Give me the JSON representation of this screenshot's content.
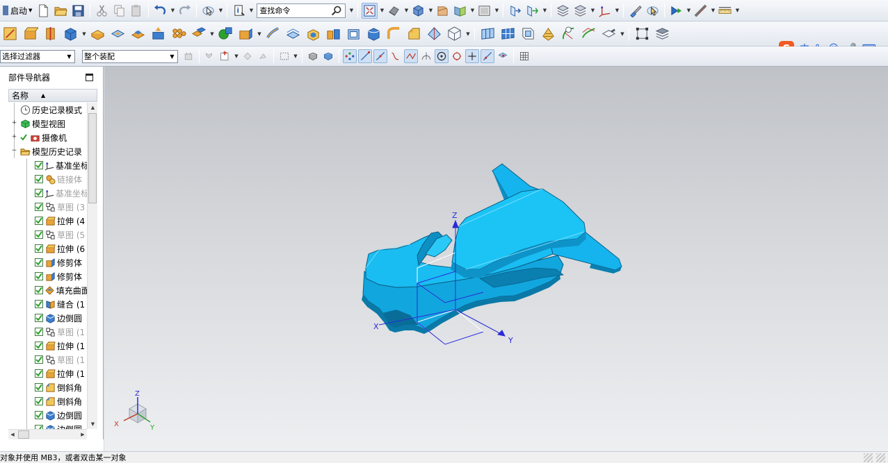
{
  "toolbar": {
    "launch_label": "启动",
    "search_value": "查找命令",
    "select_filter": "选择过滤器",
    "assembly_scope": "整个装配"
  },
  "navigator": {
    "title": "部件导航器",
    "column_name": "名称",
    "items": [
      {
        "label": "历史记录模式",
        "icon": "clock-icon",
        "level": 0,
        "expand": "",
        "checked": null,
        "dim": false
      },
      {
        "label": "模型视图",
        "icon": "model-view-icon",
        "level": 0,
        "expand": "+",
        "checked": null,
        "dim": false
      },
      {
        "label": "摄像机",
        "icon": "camera-icon",
        "level": 0,
        "expand": "+",
        "checked": true,
        "dim": false
      },
      {
        "label": "模型历史记录",
        "icon": "folder-open-icon",
        "level": 0,
        "expand": "−",
        "checked": null,
        "dim": false
      },
      {
        "label": "基准坐标系",
        "icon": "datum-csys-icon",
        "level": 1,
        "expand": "",
        "checked": true,
        "dim": false
      },
      {
        "label": "链接体",
        "icon": "linked-body-icon",
        "level": 1,
        "expand": "",
        "checked": true,
        "dim": true
      },
      {
        "label": "基准坐标系",
        "icon": "datum-csys-icon",
        "level": 1,
        "expand": "",
        "checked": true,
        "dim": true
      },
      {
        "label": "草图 (3",
        "icon": "sketch-icon",
        "level": 1,
        "expand": "",
        "checked": true,
        "dim": true
      },
      {
        "label": "拉伸 (4",
        "icon": "extrude-icon",
        "level": 1,
        "expand": "",
        "checked": true,
        "dim": false
      },
      {
        "label": "草图 (5",
        "icon": "sketch-icon",
        "level": 1,
        "expand": "",
        "checked": true,
        "dim": true
      },
      {
        "label": "拉伸 (6",
        "icon": "extrude-icon",
        "level": 1,
        "expand": "",
        "checked": true,
        "dim": false
      },
      {
        "label": "修剪体",
        "icon": "trim-body-icon",
        "level": 1,
        "expand": "",
        "checked": true,
        "dim": false
      },
      {
        "label": "修剪体",
        "icon": "trim-body-icon",
        "level": 1,
        "expand": "",
        "checked": true,
        "dim": false
      },
      {
        "label": "填充曲面",
        "icon": "fill-surface-icon",
        "level": 1,
        "expand": "",
        "checked": true,
        "dim": false
      },
      {
        "label": "缝合 (1",
        "icon": "sew-icon",
        "level": 1,
        "expand": "",
        "checked": true,
        "dim": false
      },
      {
        "label": "边倒圆",
        "icon": "edge-blend-icon",
        "level": 1,
        "expand": "",
        "checked": true,
        "dim": false
      },
      {
        "label": "草图 (1",
        "icon": "sketch-icon",
        "level": 1,
        "expand": "",
        "checked": true,
        "dim": true
      },
      {
        "label": "拉伸 (1",
        "icon": "extrude-icon",
        "level": 1,
        "expand": "",
        "checked": true,
        "dim": false
      },
      {
        "label": "草图 (1",
        "icon": "sketch-icon",
        "level": 1,
        "expand": "",
        "checked": true,
        "dim": true
      },
      {
        "label": "拉伸 (1",
        "icon": "extrude-icon",
        "level": 1,
        "expand": "",
        "checked": true,
        "dim": false
      },
      {
        "label": "倒斜角",
        "icon": "chamfer-icon",
        "level": 1,
        "expand": "",
        "checked": true,
        "dim": false
      },
      {
        "label": "倒斜角",
        "icon": "chamfer-icon",
        "level": 1,
        "expand": "",
        "checked": true,
        "dim": false
      },
      {
        "label": "边倒圆",
        "icon": "edge-blend-icon",
        "level": 1,
        "expand": "",
        "checked": true,
        "dim": false
      },
      {
        "label": "边倒圆",
        "icon": "edge-blend-icon",
        "level": 1,
        "expand": "",
        "checked": true,
        "dim": false
      }
    ]
  },
  "viewport": {
    "axis_x": "X",
    "axis_y": "Y",
    "axis_z": "Z",
    "triad_x": "X",
    "triad_y": "Y",
    "triad_z": "Z"
  },
  "status": {
    "message": "对象并使用 MB3，或者双击某一对象"
  },
  "ime": {
    "logo": "S",
    "mode": "中",
    "punct": "°,"
  },
  "colors": {
    "model_blue": "#16b4ee",
    "model_dark": "#0b6f98",
    "axis_blue": "#2a2ad8",
    "status_green": "#2ea02e"
  }
}
